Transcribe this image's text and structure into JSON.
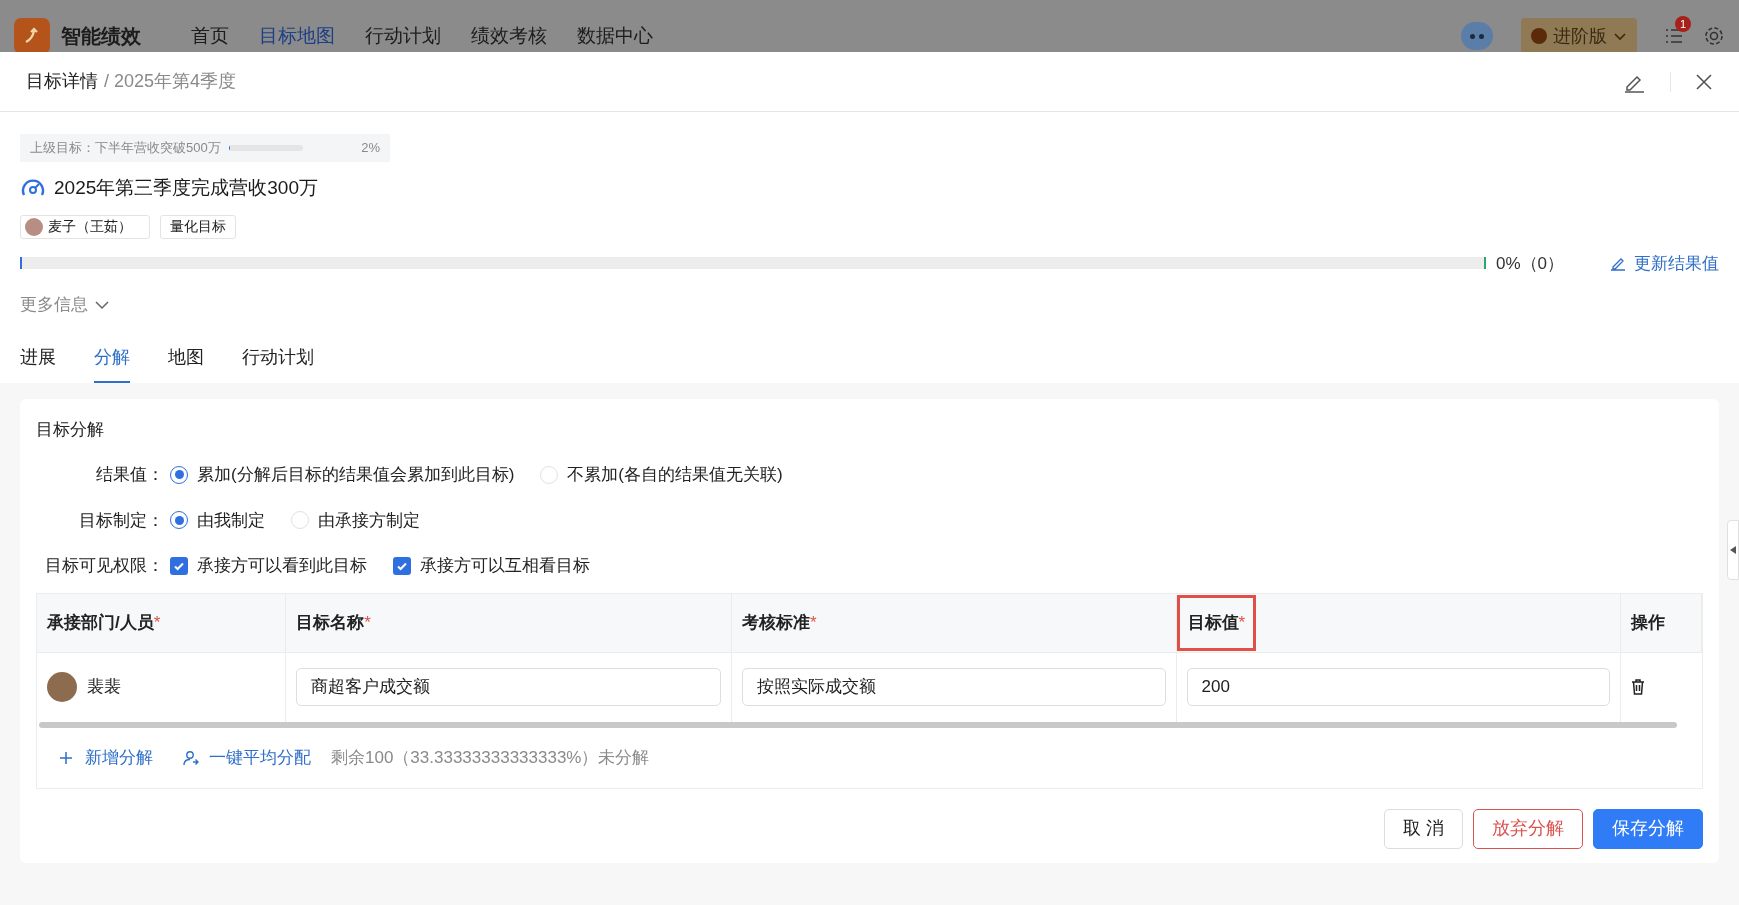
{
  "app": {
    "name": "智能绩效",
    "nav": [
      {
        "label": "首页",
        "selected": false
      },
      {
        "label": "目标地图",
        "selected": true
      },
      {
        "label": "行动计划",
        "selected": false
      },
      {
        "label": "绩效考核",
        "selected": false
      },
      {
        "label": "数据中心",
        "selected": false
      }
    ],
    "edition": "进阶版",
    "notification_count": "1"
  },
  "drawer": {
    "title": "目标详情",
    "subtitle": "/ 2025年第4季度"
  },
  "parent_goal": {
    "label": "上级目标：下半年营收突破500万",
    "level": 0.02,
    "reading": "2%"
  },
  "goal": {
    "title": "2025年第三季度完成营收300万",
    "tags": [
      {
        "kind": "person",
        "label": "麦子（王茹）"
      },
      {
        "kind": "plain",
        "label": "量化目标"
      }
    ],
    "progress": {
      "level": 0,
      "reading": "0%（0）"
    },
    "update_button": "更新结果值"
  },
  "more_info": "更多信息",
  "tabs": [
    {
      "label": "进展",
      "selected": false
    },
    {
      "label": "分解",
      "selected": true
    },
    {
      "label": "地图",
      "selected": false
    },
    {
      "label": "行动计划",
      "selected": false
    }
  ],
  "section": {
    "title": "目标分解",
    "options": [
      {
        "label": "结果值：",
        "kind": "radio",
        "choices": [
          {
            "label": "累加(分解后目标的结果值会累加到此目标)",
            "selected": true
          },
          {
            "label": "不累加(各自的结果值无关联)",
            "selected": false
          }
        ]
      },
      {
        "label": "目标制定：",
        "kind": "radio",
        "choices": [
          {
            "label": "由我制定",
            "selected": true
          },
          {
            "label": "由承接方制定",
            "selected": false
          }
        ]
      },
      {
        "label": "目标可见权限：",
        "kind": "checkbox",
        "choices": [
          {
            "label": "承接方可以看到此目标",
            "checked": true
          },
          {
            "label": "承接方可以互相看目标",
            "checked": true
          }
        ]
      }
    ]
  },
  "table": {
    "columns": [
      {
        "label": "承接部门/人员",
        "required_mark": "*",
        "highlighted": false
      },
      {
        "label": "目标名称",
        "required_mark": "*",
        "highlighted": false
      },
      {
        "label": "考核标准",
        "required_mark": "*",
        "highlighted": false
      },
      {
        "label": "目标值",
        "required_mark": "*",
        "highlighted": true
      },
      {
        "label": "操作",
        "highlighted": false
      }
    ],
    "rows": [
      {
        "person": "裴裴",
        "name": "商超客户成交额",
        "standard": "按照实际成交额",
        "value": "200"
      }
    ]
  },
  "footer": {
    "add": "新增分解",
    "distribute": "一键平均分配",
    "remaining": "剩余100（33.33333333333333%）未分解"
  },
  "buttons": [
    {
      "label": "取 消",
      "kind": "default"
    },
    {
      "label": "放弃分解",
      "kind": "danger"
    },
    {
      "label": "保存分解",
      "kind": "primary"
    }
  ]
}
